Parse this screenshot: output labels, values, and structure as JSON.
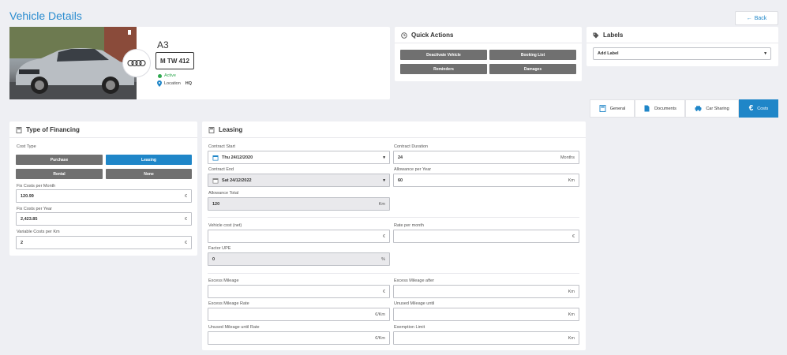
{
  "header": {
    "title": "Vehicle Details",
    "back_label": "Back"
  },
  "vehicle": {
    "model": "A3",
    "plate": "M TW 412",
    "status": "Active",
    "location_label": "Location",
    "location_value": "HQ",
    "brand_icon": "audi-rings-icon"
  },
  "quick_actions": {
    "title": "Quick Actions",
    "buttons": [
      "Deactivate Vehicle",
      "Booking List",
      "Reminders",
      "Damages"
    ]
  },
  "labels": {
    "title": "Labels",
    "add_label": "Add Label"
  },
  "tabs": [
    {
      "label": "General",
      "icon": "calculator-icon",
      "active": false
    },
    {
      "label": "Documents",
      "icon": "document-icon",
      "active": false
    },
    {
      "label": "Car Sharing",
      "icon": "car-sharing-icon",
      "active": false
    },
    {
      "label": "Costs",
      "icon": "euro-icon",
      "active": true
    }
  ],
  "financing": {
    "title": "Type of Financing",
    "cost_type_label": "Cost Type",
    "options": [
      {
        "label": "Purchase",
        "selected": false
      },
      {
        "label": "Leasing",
        "selected": true
      },
      {
        "label": "Rental",
        "selected": false
      },
      {
        "label": "None",
        "selected": false
      }
    ],
    "fix_month_label": "Fix Costs per Month",
    "fix_month_value": "120.99",
    "fix_year_label": "Fix Costs per Year",
    "fix_year_value": "2,423.85",
    "variable_label": "Variable Costs per Km",
    "variable_value": "2",
    "currency": "€"
  },
  "leasing": {
    "title": "Leasing",
    "contract_start_label": "Contract Start",
    "contract_start_value": "Thu 24/12/2020",
    "contract_duration_label": "Contract Duration",
    "contract_duration_value": "24",
    "contract_duration_unit": "Months",
    "contract_end_label": "Contract End",
    "contract_end_value": "Sat 24/12/2022",
    "allowance_year_label": "Allowance per Year",
    "allowance_year_value": "60",
    "km_unit": "Km",
    "allowance_total_label": "Allowance Total",
    "allowance_total_value": "120",
    "vehicle_cost_label": "Vehicle cost (net)",
    "rate_month_label": "Rate per month",
    "factor_label": "Factor UPE",
    "factor_value": "0",
    "percent_unit": "%",
    "excess_mileage_label": "Excess Mileage",
    "excess_after_label": "Excess Mileage after",
    "excess_rate_label": "Excess Mileage Rate",
    "unused_until_label": "Unused Mileage until",
    "unused_rate_label": "Unused Mileage until Rate",
    "exemption_label": "Exemption Limit",
    "euro_unit": "€",
    "euro_km_unit": "€/Km"
  }
}
